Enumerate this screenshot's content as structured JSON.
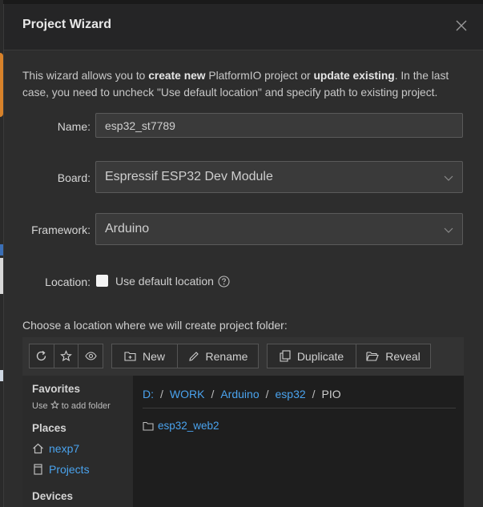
{
  "dialog": {
    "title": "Project Wizard",
    "close_icon": "close-icon"
  },
  "description": {
    "p1": "This wizard allows you to ",
    "b1": "create new",
    "p2": " PlatformIO project or ",
    "b2": "update existing",
    "p3": ". In the last case, you need to uncheck \"Use default location\" and specify path to existing project."
  },
  "form": {
    "name_label": "Name:",
    "name_value": "esp32_st7789",
    "board_label": "Board:",
    "board_value": "Espressif ESP32 Dev Module",
    "framework_label": "Framework:",
    "framework_value": "Arduino",
    "location_label": "Location:",
    "use_default_label": "Use default location",
    "use_default_checked": false
  },
  "browser": {
    "choose_label": "Choose a location where we will create project folder:",
    "toolbar": {
      "new_label": "New",
      "rename_label": "Rename",
      "duplicate_label": "Duplicate",
      "reveal_label": "Reveal"
    },
    "sidebar": {
      "favorites_heading": "Favorites",
      "favorites_hint_pre": "Use",
      "favorites_hint_post": "to add folder",
      "places_heading": "Places",
      "places": [
        {
          "label": "nexp7",
          "icon": "home-icon"
        },
        {
          "label": "Projects",
          "icon": "file-icon"
        }
      ],
      "devices_heading": "Devices"
    },
    "breadcrumb": [
      "D:",
      "WORK",
      "Arduino",
      "esp32",
      "PIO"
    ],
    "folders": [
      "esp32_web2"
    ]
  },
  "colors": {
    "link": "#4aa3ee",
    "dialog_bg": "#2d2d2d",
    "header_bg": "#252526"
  }
}
